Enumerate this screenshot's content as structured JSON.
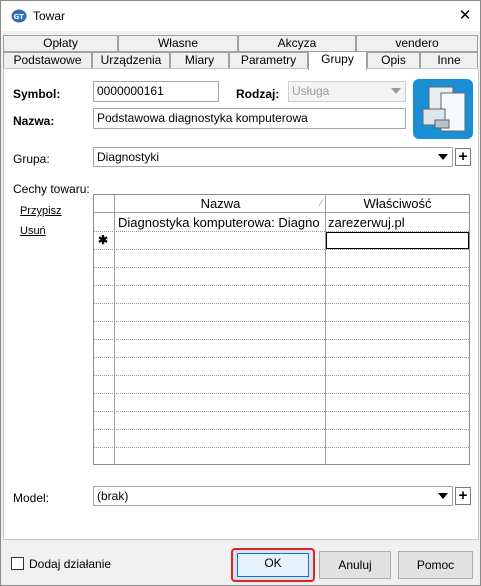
{
  "window": {
    "title": "Towar"
  },
  "tabs_row1": [
    "Opłaty",
    "Własne",
    "Akcyza",
    "vendero"
  ],
  "tabs_row2": [
    "Podstawowe",
    "Urządzenia",
    "Miary",
    "Parametry",
    "Grupy",
    "Opis",
    "Inne"
  ],
  "active_tab": "Grupy",
  "form": {
    "symbol_label": "Symbol:",
    "symbol_value": "0000000161",
    "rodzaj_label": "Rodzaj:",
    "rodzaj_value": "Usługa",
    "nazwa_label": "Nazwa:",
    "nazwa_value": "Podstawowa diagnostyka komputerowa",
    "grupa_label": "Grupa:",
    "grupa_value": "Diagnostyki",
    "cechy_label": "Cechy towaru:",
    "przypisz_link": "Przypisz",
    "usun_link": "Usuń",
    "model_label": "Model:",
    "model_value": "(brak)",
    "plus_symbol": "+"
  },
  "grid": {
    "col_nazwa": "Nazwa",
    "col_wlasciwosc": "Właściwość",
    "sort_mark": "⁄",
    "new_row_marker": "✱",
    "rows": [
      {
        "nazwa": "Diagnostyka komputerowa: Diagno",
        "wlasciwosc": "zarezerwuj.pl"
      }
    ]
  },
  "footer": {
    "dodaj_label": "Dodaj działanie",
    "ok_label": "OK",
    "anuluj_label": "Anuluj",
    "pomoc_label": "Pomoc"
  },
  "colors": {
    "highlight_border": "#d9242b",
    "focus_blue": "#0078d7"
  }
}
